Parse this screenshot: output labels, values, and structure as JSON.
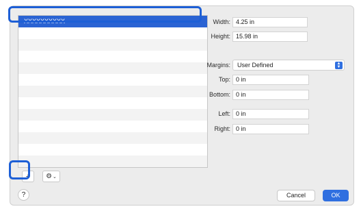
{
  "paper_list": {
    "selected_item": "XXXXXXXXXX"
  },
  "toolbar": {
    "add_label": "+",
    "action_icon": "gear-icon",
    "action_chevron": "⌄"
  },
  "size": {
    "width_label": "Width:",
    "width_value": "4.25 in",
    "height_label": "Height:",
    "height_value": "15.98 in"
  },
  "margins": {
    "label": "Margins:",
    "selected": "User Defined",
    "top_label": "Top:",
    "top_value": "0 in",
    "bottom_label": "Bottom:",
    "bottom_value": "0 in",
    "left_label": "Left:",
    "left_value": "0 in",
    "right_label": "Right:",
    "right_value": "0 in"
  },
  "footer": {
    "help_label": "?",
    "cancel_label": "Cancel",
    "ok_label": "OK"
  },
  "colors": {
    "accent": "#2f6fe0",
    "callout": "#1d5fd6",
    "selection": "#2a63d3"
  }
}
